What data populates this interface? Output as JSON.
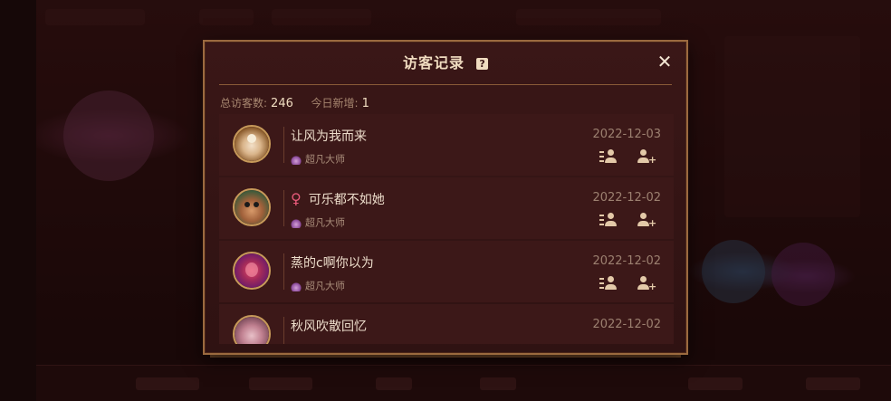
{
  "dialog": {
    "title": "访客记录",
    "help_icon": "help-icon",
    "close_icon": "close-icon",
    "close_glyph": "✕",
    "help_glyph": "?"
  },
  "stats": {
    "total_label": "总访客数:",
    "total_value": "246",
    "today_label": "今日新增:",
    "today_value": "1"
  },
  "visitors": [
    {
      "name": "让风为我而来",
      "gender_icon": "",
      "rank": "超凡大师",
      "date": "2022-12-03"
    },
    {
      "name": "可乐都不如她",
      "gender_icon": "♀",
      "rank": "超凡大师",
      "date": "2022-12-02"
    },
    {
      "name": "蒸的c啊你以为",
      "gender_icon": "",
      "rank": "超凡大师",
      "date": "2022-12-02"
    },
    {
      "name": "秋风吹散回忆",
      "gender_icon": "",
      "rank": "",
      "date": "2022-12-02"
    }
  ],
  "icons": {
    "rank": "rank-emblem-icon",
    "view_profile": "profile-list-icon",
    "add_friend": "add-friend-icon"
  },
  "colors": {
    "accent_gold": "#9b6a3f",
    "title_text": "#f0dcc0",
    "female": "#e85a7a"
  }
}
